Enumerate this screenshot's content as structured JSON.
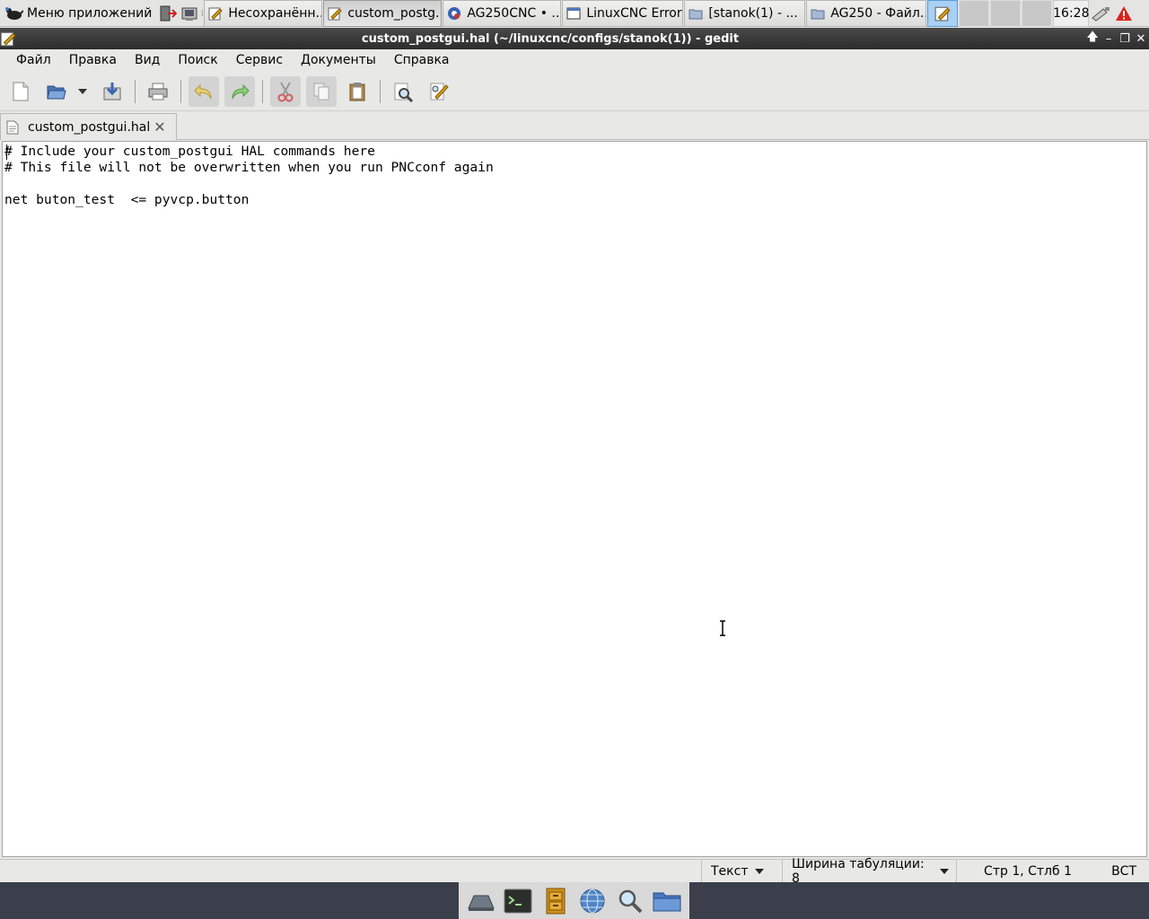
{
  "panel": {
    "app_menu_label": "Меню приложений",
    "tasks": [
      {
        "label": "Несохранённ...",
        "icon": "text-editor-icon"
      },
      {
        "label": "custom_postg...",
        "icon": "text-editor-icon",
        "active": true
      },
      {
        "label": "AG250CNC • ...",
        "icon": "linuxcnc-icon"
      },
      {
        "label": "LinuxCNC Errors",
        "icon": "window-icon"
      },
      {
        "label": "[stanok(1) - ...",
        "icon": "folder-icon"
      },
      {
        "label": "AG250 - Файл...",
        "icon": "folder-icon"
      }
    ],
    "clock": "16:28"
  },
  "window": {
    "title": "custom_postgui.hal (~/linuxcnc/configs/stanok(1)) - gedit"
  },
  "menubar": {
    "items": [
      "Файл",
      "Правка",
      "Вид",
      "Поиск",
      "Сервис",
      "Документы",
      "Справка"
    ]
  },
  "tabs": [
    {
      "label": "custom_postgui.hal"
    }
  ],
  "editor": {
    "lines": [
      "# Include your custom_postgui HAL commands here",
      "# This file will not be overwritten when you run PNCconf again",
      "",
      "net buton_test  <= pyvcp.button"
    ]
  },
  "statusbar": {
    "language": "Текст",
    "tab_width": "Ширина табуляции:  8",
    "cursor_position": "Стр 1, Стлб 1",
    "insert_mode": "ВСТ"
  },
  "colors": {
    "titlebar": "#3a3a3a",
    "dock_background": "#3a3f4b",
    "warning": "#d9241c"
  }
}
